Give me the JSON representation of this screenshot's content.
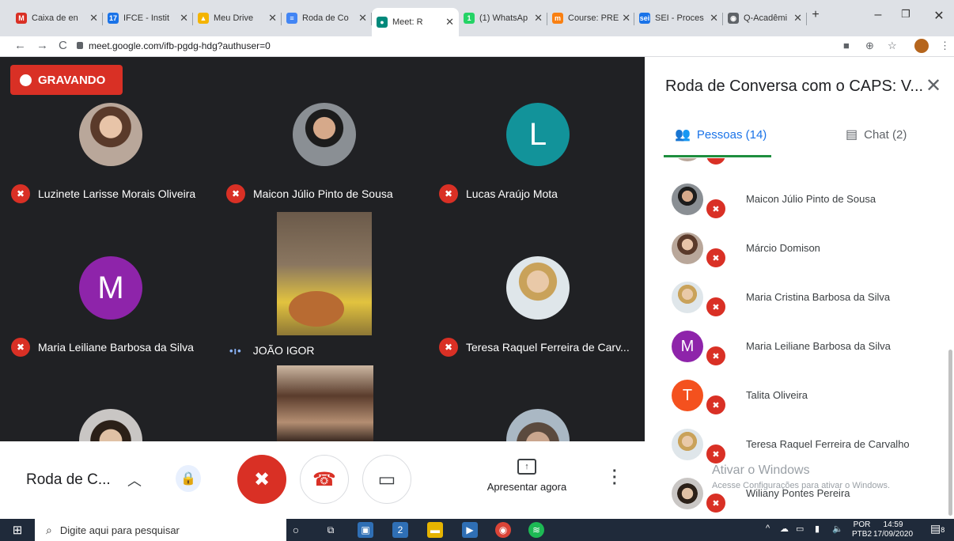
{
  "browser": {
    "tabs": [
      {
        "label": "Caixa de en",
        "icon": "gmail-icon",
        "color": "#d93025",
        "glyph": "M"
      },
      {
        "label": "IFCE - Instit",
        "icon": "ifce-icon",
        "color": "#1a73e8",
        "glyph": "17"
      },
      {
        "label": "Meu Drive",
        "icon": "drive-icon",
        "color": "#f4b400",
        "glyph": "▲"
      },
      {
        "label": "Roda de Co",
        "icon": "forms-icon",
        "color": "#4285f4",
        "glyph": "≡"
      },
      {
        "label": "Meet: R",
        "icon": "meet-icon",
        "color": "#00897b",
        "glyph": "●",
        "active": true
      },
      {
        "label": "(1) WhatsAp",
        "icon": "whatsapp-icon",
        "color": "#25d366",
        "glyph": "1"
      },
      {
        "label": "Course: PRE",
        "icon": "moodle-icon",
        "color": "#f98012",
        "glyph": "m"
      },
      {
        "label": "SEI - Proces",
        "icon": "sei-icon",
        "color": "#1a73e8",
        "glyph": "sei"
      },
      {
        "label": "Q-Acadêmi",
        "icon": "globe-icon",
        "color": "#5f6368",
        "glyph": "◉"
      }
    ],
    "url": "meet.google.com/ifb-pgdg-hdg?authuser=0"
  },
  "meeting": {
    "recording_label": "GRAVANDO",
    "tiles": [
      {
        "name": "Luzinete Larisse Morais Oliveira",
        "muted": true
      },
      {
        "name": "Maicon Júlio Pinto de Sousa",
        "muted": true
      },
      {
        "name": "Lucas Araújo Mota",
        "muted": true,
        "initial": "L",
        "color": "#12939a"
      },
      {
        "name": "Maria Leiliane Barbosa da Silva",
        "muted": true,
        "initial": "M",
        "color": "#8e24aa"
      },
      {
        "name": "JOÃO IGOR",
        "muted": false
      },
      {
        "name": "Teresa Raquel Ferreira de Carv...",
        "muted": true
      }
    ],
    "title_short": "Roda de C...",
    "present_label": "Apresentar agora"
  },
  "panel": {
    "title": "Roda de Conversa com o CAPS: V...",
    "people_tab": "Pessoas (14)",
    "chat_tab": "Chat (2)",
    "participants": [
      {
        "name": "Maicon Júlio Pinto de Sousa",
        "kind": "photo"
      },
      {
        "name": "Márcio Domison",
        "kind": "photo"
      },
      {
        "name": "Maria Cristina Barbosa da Silva",
        "kind": "photo"
      },
      {
        "name": "Maria Leiliane Barbosa da Silva",
        "initial": "M",
        "color": "#8e24aa"
      },
      {
        "name": "Talita Oliveira",
        "initial": "T",
        "color": "#f4511e"
      },
      {
        "name": "Teresa Raquel Ferreira de Carvalho",
        "kind": "photo"
      },
      {
        "name": "Wiliany Pontes Pereira",
        "kind": "photo"
      }
    ]
  },
  "watermark": {
    "line1": "Ativar o Windows",
    "line2": "Acesse Configurações para ativar o Windows."
  },
  "taskbar": {
    "search_placeholder": "Digite aqui para pesquisar",
    "lang_top": "POR",
    "lang_bottom": "PTB2",
    "time": "14:59",
    "date": "17/09/2020",
    "notifications": "8",
    "mail_badge": "2"
  }
}
